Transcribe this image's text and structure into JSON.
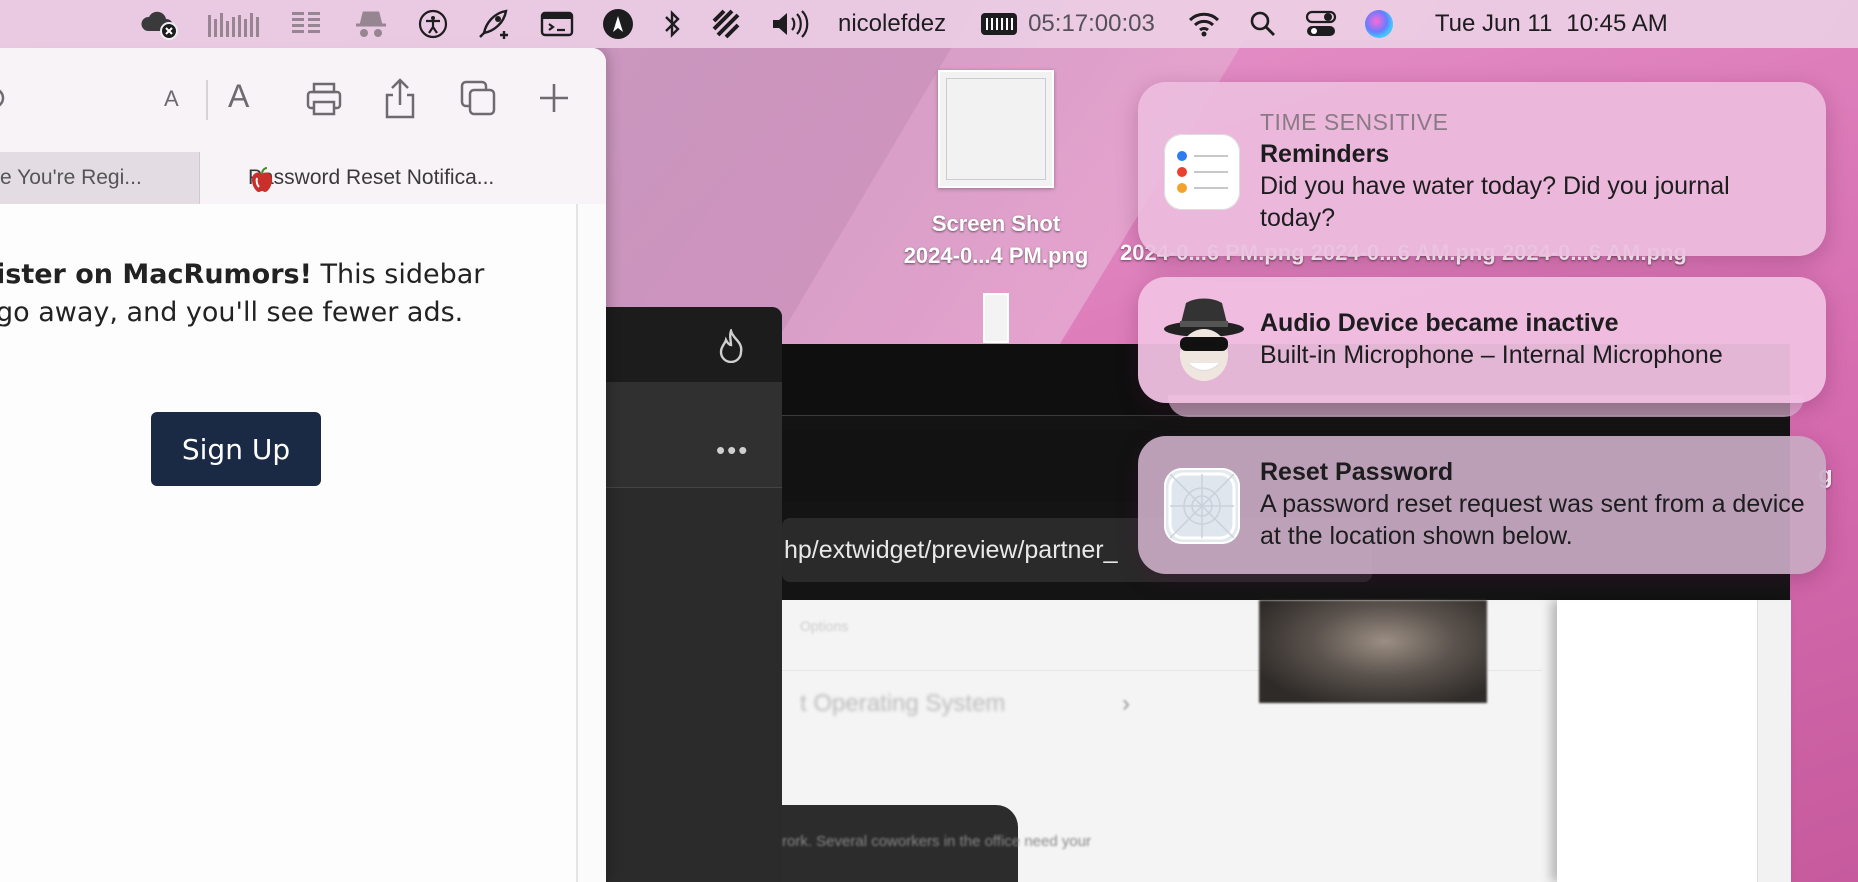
{
  "menubar": {
    "user": "nicolefdez",
    "timer": "05:17:00:03",
    "date": "Tue Jun 11",
    "time": "10:45 AM"
  },
  "browser": {
    "tabs": [
      {
        "label": "e You're Regi..."
      },
      {
        "label": "Password Reset Notifica..."
      }
    ],
    "register_bold": "ister on MacRumors!",
    "register_rest": " This sidebar",
    "register_line2": "go away, and you'll see fewer ads.",
    "signup_label": "Sign Up",
    "font_small": "A",
    "font_large": "A"
  },
  "desktop": {
    "file_label_line1": "Screen Shot",
    "file_label_line2": "2024-0...4 PM.png",
    "background_labels": "2024-0...6 PM.png   2024-0...6 AM.png   2024-0...6 AM.png",
    "stray_letter": "g"
  },
  "dark_app": {
    "url_text": "hp/extwidget/preview/partner_",
    "menu_dots": "•••",
    "blurred_row": "t Operating System",
    "blurred_popup": "rork. Several coworkers in the office need your"
  },
  "notifications": [
    {
      "kicker": "TIME SENSITIVE",
      "title": "Reminders",
      "body": "Did you have water today?  Did you journal today?",
      "icon": "reminders-icon"
    },
    {
      "title": "Audio Device became inactive",
      "body": "Built-in Microphone – Internal Microphone",
      "icon": "incognito-spy-icon"
    },
    {
      "title": "Reset Password",
      "body": "A password reset request was sent from a device at the location shown below.",
      "icon": "generic-app-icon"
    }
  ],
  "colors": {
    "signup_bg": "#1b2a44",
    "notif_bg": "#ecbcde"
  }
}
